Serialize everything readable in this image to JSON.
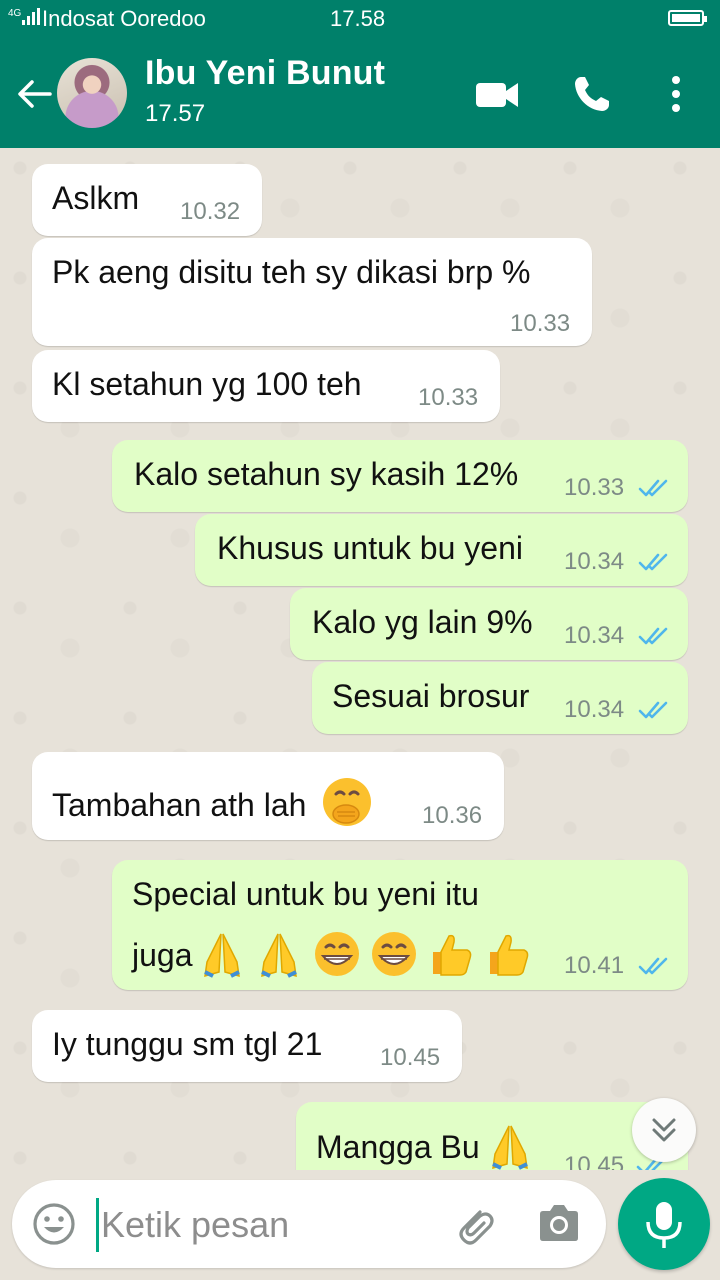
{
  "status_bar": {
    "network": "4G",
    "carrier": "Indosat Ooredoo",
    "time": "17.58"
  },
  "header": {
    "contact_name": "Ibu Yeni Bunut",
    "subtitle": "17.57"
  },
  "messages": [
    {
      "dir": "in",
      "text": "Aslkm",
      "time": "10.32"
    },
    {
      "dir": "in",
      "text": "Pk aeng disitu teh sy dikasi brp %",
      "time": "10.33"
    },
    {
      "dir": "in",
      "text": "Kl setahun yg 100 teh",
      "time": "10.33"
    },
    {
      "dir": "out",
      "text": "Kalo setahun sy kasih 12%",
      "time": "10.33"
    },
    {
      "dir": "out",
      "text": "Khusus untuk bu yeni",
      "time": "10.34"
    },
    {
      "dir": "out",
      "text": "Kalo yg lain 9%",
      "time": "10.34"
    },
    {
      "dir": "out",
      "text": "Sesuai brosur",
      "time": "10.34"
    },
    {
      "dir": "in",
      "text": "Tambahan ath lah",
      "time": "10.36"
    },
    {
      "dir": "out",
      "text": "Special untuk bu yeni itu",
      "text2": "juga",
      "time": "10.41"
    },
    {
      "dir": "in",
      "text": "Iy tunggu sm tgl 21",
      "time": "10.45"
    },
    {
      "dir": "out",
      "text": "Mangga Bu",
      "time": "10.45"
    }
  ],
  "composer": {
    "placeholder": "Ketik pesan"
  },
  "colors": {
    "header": "#00806a",
    "incoming": "#ffffff",
    "outgoing": "#e1fec7",
    "read_ticks": "#4fb6ec",
    "accent": "#00a884"
  },
  "icons": {
    "back": "arrow-left-icon",
    "video": "video-call-icon",
    "call": "phone-icon",
    "menu": "more-vert-icon",
    "emoji": "smiley-icon",
    "attach": "paperclip-icon",
    "camera": "camera-icon",
    "mic": "mic-icon",
    "scroll": "chevron-double-down-icon"
  }
}
